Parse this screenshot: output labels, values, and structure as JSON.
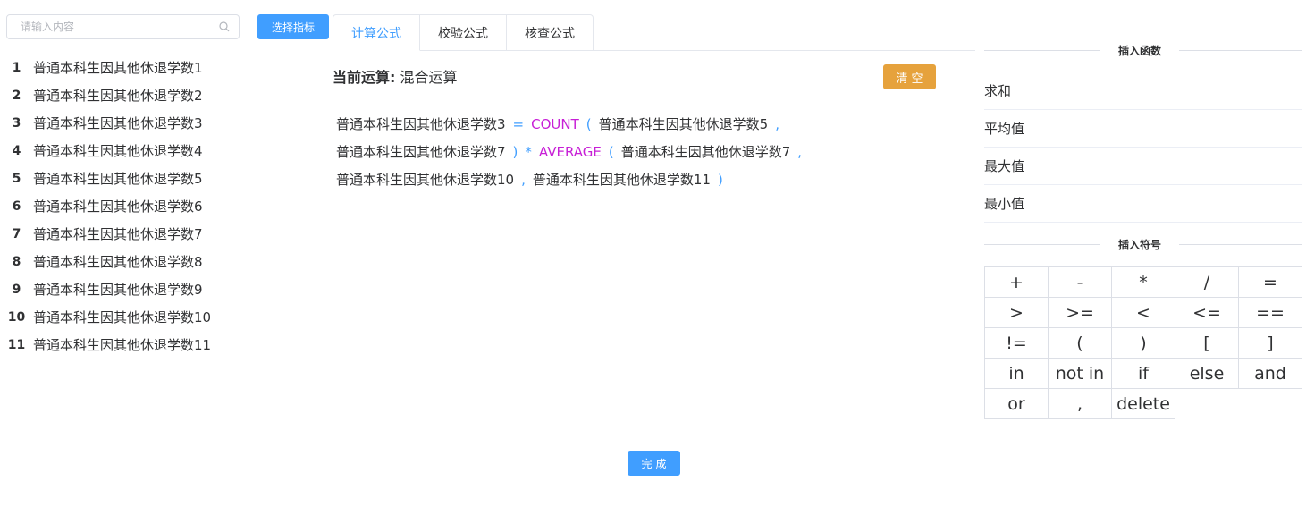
{
  "search": {
    "placeholder": "请输入内容"
  },
  "indicators": [
    {
      "no": "1",
      "label": "普通本科生因其他休退学数1"
    },
    {
      "no": "2",
      "label": "普通本科生因其他休退学数2"
    },
    {
      "no": "3",
      "label": "普通本科生因其他休退学数3"
    },
    {
      "no": "4",
      "label": "普通本科生因其他休退学数4"
    },
    {
      "no": "5",
      "label": "普通本科生因其他休退学数5"
    },
    {
      "no": "6",
      "label": "普通本科生因其他休退学数6"
    },
    {
      "no": "7",
      "label": "普通本科生因其他休退学数7"
    },
    {
      "no": "8",
      "label": "普通本科生因其他休退学数8"
    },
    {
      "no": "9",
      "label": "普通本科生因其他休退学数9"
    },
    {
      "no": "10",
      "label": "普通本科生因其他休退学数10"
    },
    {
      "no": "11",
      "label": "普通本科生因其他休退学数11"
    }
  ],
  "toolbar": {
    "select_label": "选择指标"
  },
  "tabs": [
    {
      "label": "计算公式"
    },
    {
      "label": "校验公式"
    },
    {
      "label": "核查公式"
    }
  ],
  "current_op": {
    "label": "当前运算:",
    "value": "混合运算"
  },
  "clear_label": "清空",
  "formula_lines": [
    [
      {
        "t": "普通本科生因其他休退学数3",
        "k": "ind"
      },
      {
        "t": "=",
        "k": "op"
      },
      {
        "t": "COUNT",
        "k": "fn"
      },
      {
        "t": "(",
        "k": "op"
      },
      {
        "t": "普通本科生因其他休退学数5",
        "k": "ind"
      },
      {
        "t": ",",
        "k": "op"
      }
    ],
    [
      {
        "t": "普通本科生因其他休退学数7",
        "k": "ind"
      },
      {
        "t": ")",
        "k": "op"
      },
      {
        "t": "*",
        "k": "op"
      },
      {
        "t": "AVERAGE",
        "k": "fn"
      },
      {
        "t": "(",
        "k": "op"
      },
      {
        "t": "普通本科生因其他休退学数7",
        "k": "ind"
      },
      {
        "t": ",",
        "k": "op"
      }
    ],
    [
      {
        "t": "普通本科生因其他休退学数10",
        "k": "ind"
      },
      {
        "t": ",",
        "k": "op"
      },
      {
        "t": "普通本科生因其他休退学数11",
        "k": "ind"
      },
      {
        "t": ")",
        "k": "op"
      }
    ]
  ],
  "functions": {
    "title": "插入函数",
    "items": [
      "求和",
      "平均值",
      "最大值",
      "最小值"
    ]
  },
  "symbols": {
    "title": "插入符号",
    "rows": [
      [
        "+",
        "-",
        "*",
        "/",
        "="
      ],
      [
        ">",
        ">=",
        "<",
        "<=",
        "=="
      ],
      [
        "!=",
        "(",
        ")",
        "[",
        "]"
      ],
      [
        "in",
        "not in",
        "if",
        "else",
        "and"
      ],
      [
        "or",
        ",",
        "delete"
      ]
    ]
  },
  "done_label": "完成",
  "colors": {
    "primary": "#409eff",
    "warning": "#e6a23c",
    "function": "#c71fd6"
  }
}
